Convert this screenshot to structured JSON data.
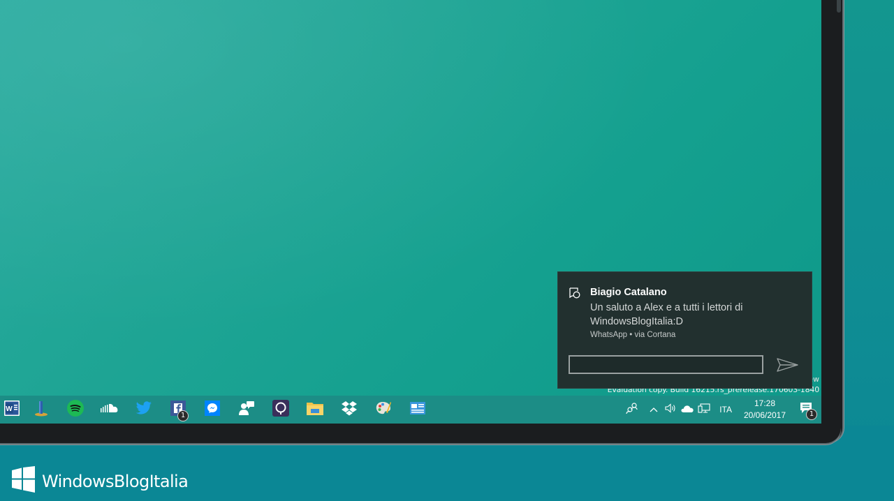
{
  "notification": {
    "sender": "Biagio Catalano",
    "message": "Un saluto a Alex e a tutti i lettori di WindowsBlogItalia:D",
    "source": "WhatsApp • via Cortana",
    "reply_value": ""
  },
  "desktop": {
    "watermark_tail": "ew",
    "watermark": "Evaluation copy. Build 16215.rs_prerelease.170603-1840"
  },
  "taskbar": {
    "apps": [
      {
        "name": "Word",
        "icon": "word-icon"
      },
      {
        "name": "Bridge",
        "icon": "bridge-app-icon"
      },
      {
        "name": "Spotify",
        "icon": "spotify-icon"
      },
      {
        "name": "SoundCloud",
        "icon": "soundcloud-icon"
      },
      {
        "name": "Twitter",
        "icon": "twitter-icon"
      },
      {
        "name": "Facebook",
        "icon": "facebook-icon",
        "badge": "1"
      },
      {
        "name": "Messenger",
        "icon": "messenger-icon"
      },
      {
        "name": "People",
        "icon": "people-icon"
      },
      {
        "name": "Cortana",
        "icon": "cortana-icon"
      },
      {
        "name": "File Explorer",
        "icon": "file-explorer-icon"
      },
      {
        "name": "Dropbox",
        "icon": "dropbox-icon"
      },
      {
        "name": "Paint",
        "icon": "paint-icon"
      },
      {
        "name": "News",
        "icon": "news-icon"
      }
    ],
    "language": "ITA",
    "time": "17:28",
    "date": "20/06/2017",
    "notifications_badge": "1"
  },
  "branding": {
    "logo_text": "WindowsBlogItalia"
  },
  "colors": {
    "facebook": "#3b5998",
    "spotify": "#1db954",
    "twitter": "#1da1f2",
    "messenger": "#0084ff",
    "word": "#2b579a"
  }
}
